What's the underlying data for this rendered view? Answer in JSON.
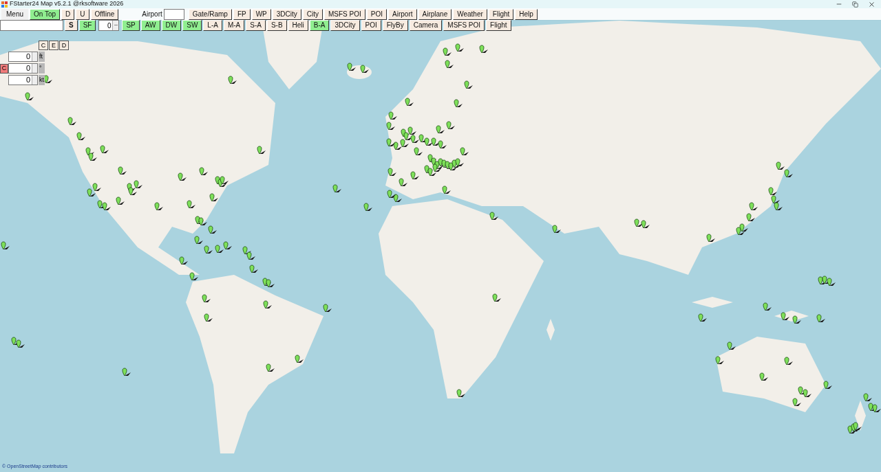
{
  "window": {
    "title": "FStarter24 Map v5.2.1 @rksoftware 2026"
  },
  "toolbar_row_1": [
    {
      "kind": "flat",
      "label": "Menu"
    },
    {
      "kind": "button",
      "label": "On Top",
      "on": true
    },
    {
      "kind": "button",
      "label": "D",
      "on": false
    },
    {
      "kind": "button",
      "label": "U",
      "on": false
    },
    {
      "kind": "button",
      "label": "Offline",
      "on": false
    },
    {
      "kind": "label",
      "label": "Airport"
    },
    {
      "kind": "field"
    },
    {
      "kind": "button",
      "label": "Gate/Ramp",
      "on": false
    },
    {
      "kind": "button",
      "label": "FP",
      "on": false
    },
    {
      "kind": "button",
      "label": "WP",
      "on": false
    },
    {
      "kind": "button",
      "label": "3DCity",
      "on": false
    },
    {
      "kind": "button",
      "label": "City",
      "on": false
    },
    {
      "kind": "button",
      "label": "MSFS POI",
      "on": false
    },
    {
      "kind": "button",
      "label": "POI",
      "on": false
    },
    {
      "kind": "button",
      "label": "Airport",
      "on": false
    },
    {
      "kind": "button",
      "label": "Airplane",
      "on": false
    },
    {
      "kind": "button",
      "label": "Weather",
      "on": false
    },
    {
      "kind": "button",
      "label": "Flight",
      "on": false
    },
    {
      "kind": "button",
      "label": "Help",
      "on": false
    }
  ],
  "toolbar_row_2": [
    {
      "kind": "field"
    },
    {
      "kind": "bold",
      "label": "S",
      "on": false
    },
    {
      "kind": "button",
      "label": "SF",
      "on": true
    },
    {
      "kind": "spinner",
      "value": "0"
    },
    {
      "kind": "button",
      "label": "SP",
      "on": true
    },
    {
      "kind": "button",
      "label": "AW",
      "on": true
    },
    {
      "kind": "button",
      "label": "DW",
      "on": true
    },
    {
      "kind": "button",
      "label": "SW",
      "on": true
    },
    {
      "kind": "button",
      "label": "L-A",
      "on": false
    },
    {
      "kind": "button",
      "label": "M-A",
      "on": false
    },
    {
      "kind": "button",
      "label": "S-A",
      "on": false
    },
    {
      "kind": "button",
      "label": "S-B",
      "on": false
    },
    {
      "kind": "button",
      "label": "Heli",
      "on": false
    },
    {
      "kind": "button",
      "label": "B-A",
      "on": true
    },
    {
      "kind": "button",
      "label": "3DCity",
      "on": false
    },
    {
      "kind": "button",
      "label": "POI",
      "on": false
    },
    {
      "kind": "button",
      "label": "FlyBy",
      "on": false
    },
    {
      "kind": "button",
      "label": "Camera",
      "on": false
    },
    {
      "kind": "button",
      "label": "MSFS POI",
      "on": false
    },
    {
      "kind": "button",
      "label": "Flight",
      "on": false
    }
  ],
  "side_panel": {
    "buttons": [
      "C",
      "E",
      "D"
    ],
    "rows": [
      {
        "value": "0",
        "unit": "ft",
        "reset_label": null
      },
      {
        "value": "0",
        "unit": "°",
        "reset_label": "C"
      },
      {
        "value": "0",
        "unit": "kt",
        "reset_label": null
      }
    ]
  },
  "map": {
    "kind": "picture",
    "attribution": "© OpenStreetMap contributors"
  }
}
